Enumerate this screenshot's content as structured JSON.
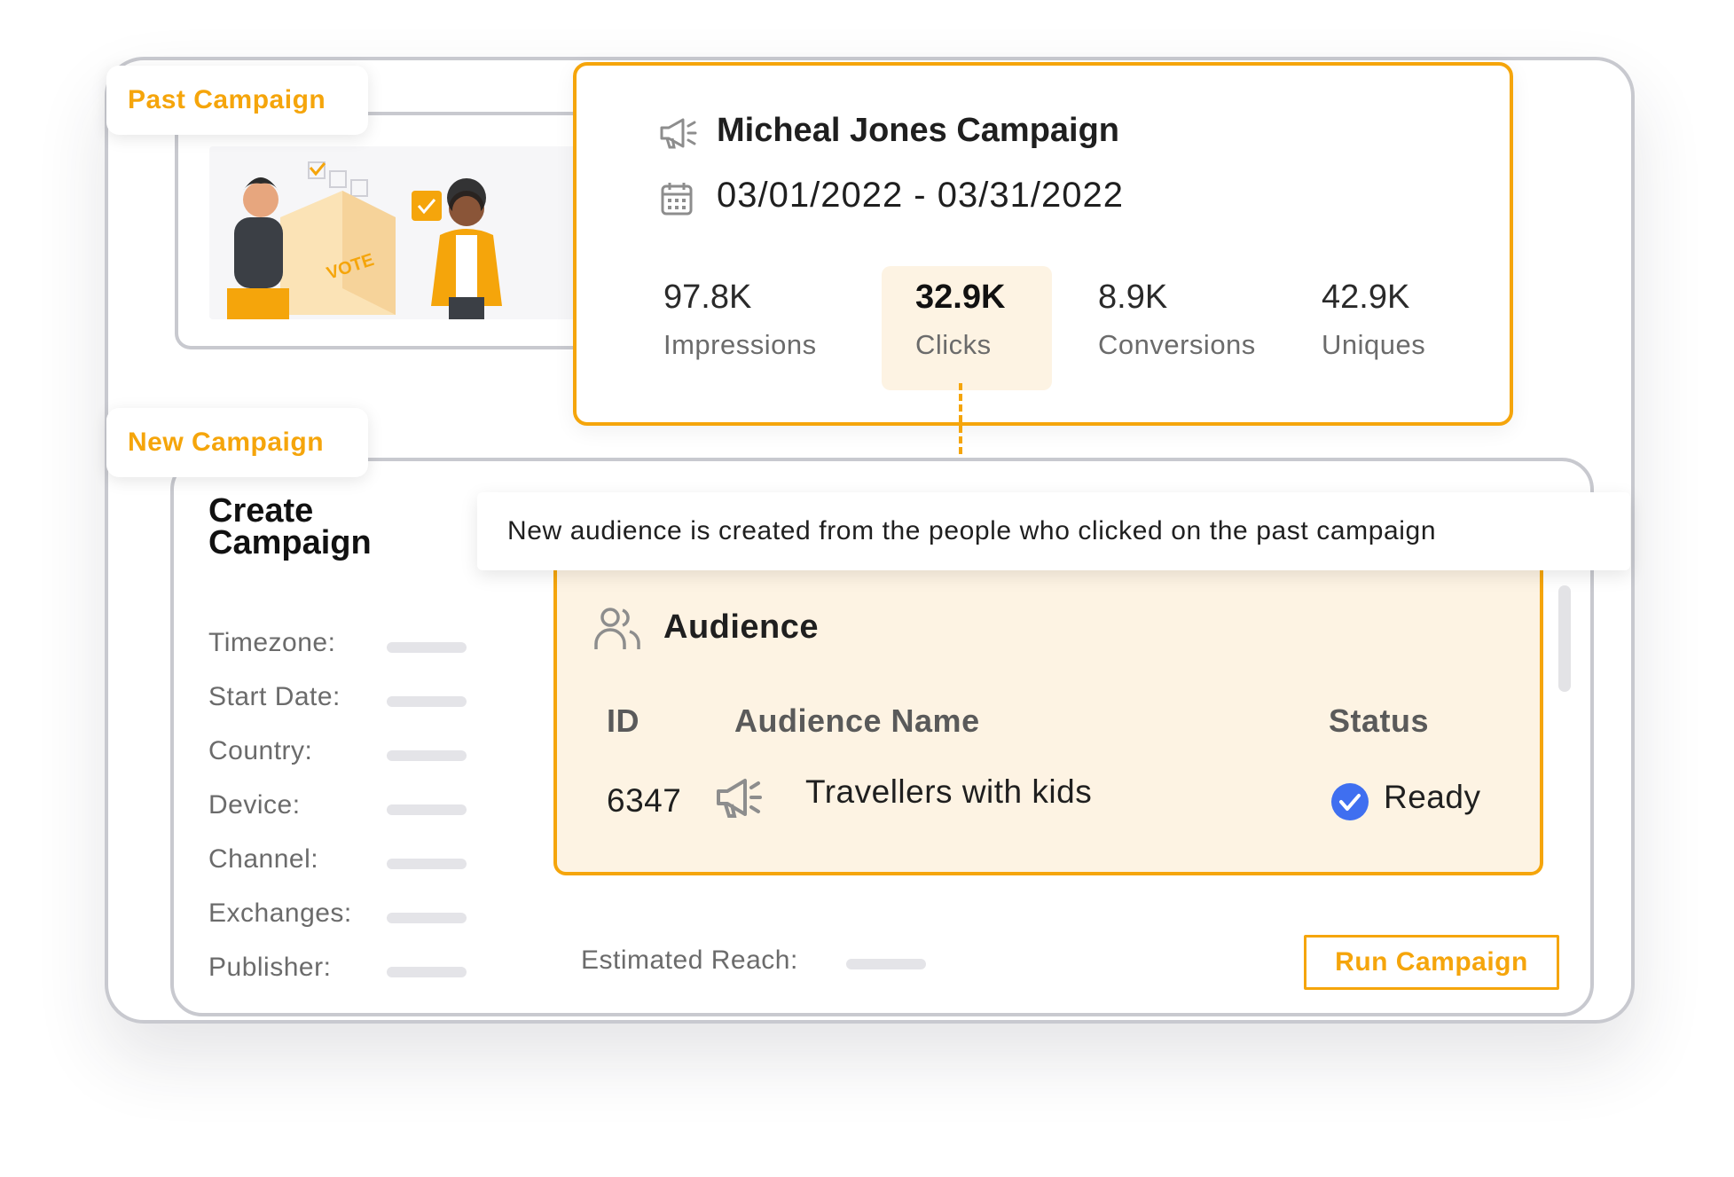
{
  "tabs": {
    "past": "Past Campaign",
    "new": "New Campaign"
  },
  "summary": {
    "name": "Micheal Jones Campaign",
    "dates": "03/01/2022 - 03/31/2022",
    "metrics": [
      {
        "value": "97.8K",
        "label": "Impressions"
      },
      {
        "value": "32.9K",
        "label": "Clicks",
        "highlighted": true
      },
      {
        "value": "8.9K",
        "label": "Conversions"
      },
      {
        "value": "42.9K",
        "label": "Uniques"
      }
    ]
  },
  "illustration": {
    "text": "VOTE"
  },
  "create": {
    "title": "Create Campaign",
    "fields": [
      "Timezone:",
      "Start Date:",
      "Country:",
      "Device:",
      "Channel:",
      "Exchanges:",
      "Publisher:"
    ]
  },
  "tooltip": "New audience is created from the people who clicked on the past campaign",
  "audience": {
    "title": "Audience",
    "columns": [
      "ID",
      "Audience Name",
      "Status"
    ],
    "rows": [
      {
        "id": "6347",
        "name": "Travellers with kids",
        "status": "Ready"
      }
    ]
  },
  "footer": {
    "reach_label": "Estimated Reach:",
    "run_button": "Run Campaign"
  },
  "colors": {
    "accent": "#f5a50b",
    "highlight_bg": "#fdf3e3",
    "check": "#3f6ff0",
    "frame": "#c8c9cf"
  }
}
